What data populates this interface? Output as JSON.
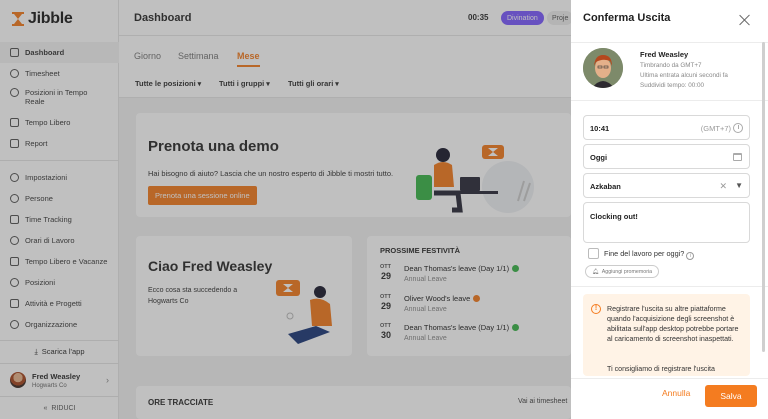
{
  "brand": {
    "name": "Jibble",
    "accent": "#f47c20"
  },
  "sidebar": {
    "items": [
      {
        "label": "Dashboard",
        "icon": "dashboard-icon",
        "active": true
      },
      {
        "label": "Timesheet",
        "icon": "clock-icon"
      },
      {
        "label": "Posizioni in Tempo Reale",
        "icon": "location-icon"
      },
      {
        "label": "Tempo Libero",
        "icon": "calendar-icon"
      },
      {
        "label": "Report",
        "icon": "report-icon"
      },
      {
        "label": "Impostazioni",
        "icon": "settings-icon"
      },
      {
        "label": "Persone",
        "icon": "people-icon"
      },
      {
        "label": "Time Tracking",
        "icon": "time-tracking-icon"
      },
      {
        "label": "Orari di Lavoro",
        "icon": "schedule-icon"
      },
      {
        "label": "Tempo Libero e Vacanze",
        "icon": "vacation-icon"
      },
      {
        "label": "Posizioni",
        "icon": "pin-icon"
      },
      {
        "label": "Attività e Progetti",
        "icon": "tag-icon"
      },
      {
        "label": "Organizzazione",
        "icon": "gear-icon"
      }
    ],
    "download": "Scarica l'app",
    "user": {
      "name": "Fred Weasley",
      "org": "Hogwarts Co"
    },
    "collapse": "RIDUCI"
  },
  "header": {
    "title": "Dashboard",
    "timer": "00:35",
    "division": "Divination",
    "project": "Proje"
  },
  "tabs": [
    "Giorno",
    "Settimana",
    "Mese"
  ],
  "filters": [
    "Tutte le posizioni",
    "Tutti i gruppi",
    "Tutti gli orari"
  ],
  "demo": {
    "title": "Prenota una demo",
    "text": "Hai bisogno di aiuto? Lascia che un nostro esperto di Jibble ti mostri tutto.",
    "button": "Prenota una sessione online"
  },
  "hello": {
    "title": "Ciao Fred Weasley",
    "text": "Ecco cosa sta succedendo a Hogwarts Co"
  },
  "holidays": {
    "title": "PROSSIME FESTIVITÀ",
    "items": [
      {
        "month": "OTT",
        "day": "29",
        "title": "Dean Thomas's leave (Day 1/1)",
        "type": "Annual Leave",
        "status_color": "#3cb54a"
      },
      {
        "month": "OTT",
        "day": "29",
        "title": "Oliver Wood's leave",
        "type": "Annual Leave",
        "status_color": "#f47c20"
      },
      {
        "month": "OTT",
        "day": "30",
        "title": "Dean Thomas's leave (Day 1/1)",
        "type": "Annual Leave",
        "status_color": "#3cb54a"
      }
    ]
  },
  "tracked": {
    "title": "ORE TRACCIATE",
    "link": "Vai ai timesheet"
  },
  "panel": {
    "title": "Conferma Uscita",
    "person": {
      "name": "Fred Weasley",
      "lines": [
        "Timbrando da GMT+7",
        "Ultima entrata alcuni secondi fa",
        "Suddividi tempo: 00:00"
      ]
    },
    "time": "10:41",
    "timezone": "(GMT+7)",
    "date": "Oggi",
    "location": "Azkaban",
    "note": "Clocking out!",
    "end_of_day": "Fine del lavoro per oggi?",
    "add_project": "Aggiungi promemoria",
    "warning": "Registrare l'uscita su altre piattaforme quando l'acquisizione degli screenshot è abilitata sull'app desktop potrebbe portare al caricamento di screenshot inaspettati.",
    "warning2": "Ti consigliamo di registrare l'uscita",
    "cancel": "Annulla",
    "save": "Salva"
  }
}
